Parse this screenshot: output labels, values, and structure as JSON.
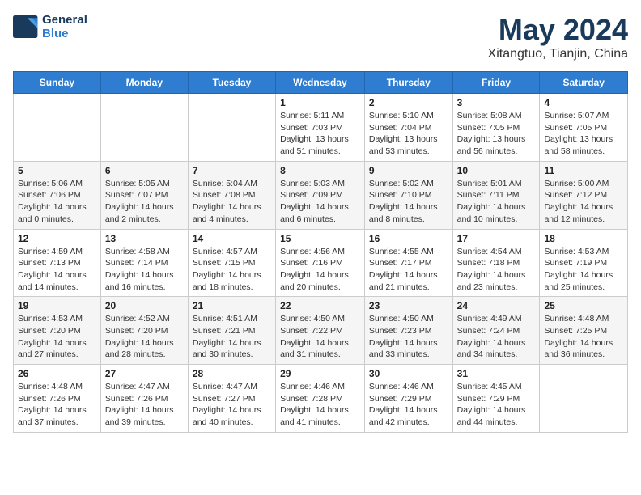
{
  "header": {
    "logo_line1": "General",
    "logo_line2": "Blue",
    "month_title": "May 2024",
    "location": "Xitangtuo, Tianjin, China"
  },
  "weekdays": [
    "Sunday",
    "Monday",
    "Tuesday",
    "Wednesday",
    "Thursday",
    "Friday",
    "Saturday"
  ],
  "weeks": [
    [
      {
        "day": "",
        "content": ""
      },
      {
        "day": "",
        "content": ""
      },
      {
        "day": "",
        "content": ""
      },
      {
        "day": "1",
        "content": "Sunrise: 5:11 AM\nSunset: 7:03 PM\nDaylight: 13 hours and 51 minutes."
      },
      {
        "day": "2",
        "content": "Sunrise: 5:10 AM\nSunset: 7:04 PM\nDaylight: 13 hours and 53 minutes."
      },
      {
        "day": "3",
        "content": "Sunrise: 5:08 AM\nSunset: 7:05 PM\nDaylight: 13 hours and 56 minutes."
      },
      {
        "day": "4",
        "content": "Sunrise: 5:07 AM\nSunset: 7:05 PM\nDaylight: 13 hours and 58 minutes."
      }
    ],
    [
      {
        "day": "5",
        "content": "Sunrise: 5:06 AM\nSunset: 7:06 PM\nDaylight: 14 hours and 0 minutes."
      },
      {
        "day": "6",
        "content": "Sunrise: 5:05 AM\nSunset: 7:07 PM\nDaylight: 14 hours and 2 minutes."
      },
      {
        "day": "7",
        "content": "Sunrise: 5:04 AM\nSunset: 7:08 PM\nDaylight: 14 hours and 4 minutes."
      },
      {
        "day": "8",
        "content": "Sunrise: 5:03 AM\nSunset: 7:09 PM\nDaylight: 14 hours and 6 minutes."
      },
      {
        "day": "9",
        "content": "Sunrise: 5:02 AM\nSunset: 7:10 PM\nDaylight: 14 hours and 8 minutes."
      },
      {
        "day": "10",
        "content": "Sunrise: 5:01 AM\nSunset: 7:11 PM\nDaylight: 14 hours and 10 minutes."
      },
      {
        "day": "11",
        "content": "Sunrise: 5:00 AM\nSunset: 7:12 PM\nDaylight: 14 hours and 12 minutes."
      }
    ],
    [
      {
        "day": "12",
        "content": "Sunrise: 4:59 AM\nSunset: 7:13 PM\nDaylight: 14 hours and 14 minutes."
      },
      {
        "day": "13",
        "content": "Sunrise: 4:58 AM\nSunset: 7:14 PM\nDaylight: 14 hours and 16 minutes."
      },
      {
        "day": "14",
        "content": "Sunrise: 4:57 AM\nSunset: 7:15 PM\nDaylight: 14 hours and 18 minutes."
      },
      {
        "day": "15",
        "content": "Sunrise: 4:56 AM\nSunset: 7:16 PM\nDaylight: 14 hours and 20 minutes."
      },
      {
        "day": "16",
        "content": "Sunrise: 4:55 AM\nSunset: 7:17 PM\nDaylight: 14 hours and 21 minutes."
      },
      {
        "day": "17",
        "content": "Sunrise: 4:54 AM\nSunset: 7:18 PM\nDaylight: 14 hours and 23 minutes."
      },
      {
        "day": "18",
        "content": "Sunrise: 4:53 AM\nSunset: 7:19 PM\nDaylight: 14 hours and 25 minutes."
      }
    ],
    [
      {
        "day": "19",
        "content": "Sunrise: 4:53 AM\nSunset: 7:20 PM\nDaylight: 14 hours and 27 minutes."
      },
      {
        "day": "20",
        "content": "Sunrise: 4:52 AM\nSunset: 7:20 PM\nDaylight: 14 hours and 28 minutes."
      },
      {
        "day": "21",
        "content": "Sunrise: 4:51 AM\nSunset: 7:21 PM\nDaylight: 14 hours and 30 minutes."
      },
      {
        "day": "22",
        "content": "Sunrise: 4:50 AM\nSunset: 7:22 PM\nDaylight: 14 hours and 31 minutes."
      },
      {
        "day": "23",
        "content": "Sunrise: 4:50 AM\nSunset: 7:23 PM\nDaylight: 14 hours and 33 minutes."
      },
      {
        "day": "24",
        "content": "Sunrise: 4:49 AM\nSunset: 7:24 PM\nDaylight: 14 hours and 34 minutes."
      },
      {
        "day": "25",
        "content": "Sunrise: 4:48 AM\nSunset: 7:25 PM\nDaylight: 14 hours and 36 minutes."
      }
    ],
    [
      {
        "day": "26",
        "content": "Sunrise: 4:48 AM\nSunset: 7:26 PM\nDaylight: 14 hours and 37 minutes."
      },
      {
        "day": "27",
        "content": "Sunrise: 4:47 AM\nSunset: 7:26 PM\nDaylight: 14 hours and 39 minutes."
      },
      {
        "day": "28",
        "content": "Sunrise: 4:47 AM\nSunset: 7:27 PM\nDaylight: 14 hours and 40 minutes."
      },
      {
        "day": "29",
        "content": "Sunrise: 4:46 AM\nSunset: 7:28 PM\nDaylight: 14 hours and 41 minutes."
      },
      {
        "day": "30",
        "content": "Sunrise: 4:46 AM\nSunset: 7:29 PM\nDaylight: 14 hours and 42 minutes."
      },
      {
        "day": "31",
        "content": "Sunrise: 4:45 AM\nSunset: 7:29 PM\nDaylight: 14 hours and 44 minutes."
      },
      {
        "day": "",
        "content": ""
      }
    ]
  ]
}
